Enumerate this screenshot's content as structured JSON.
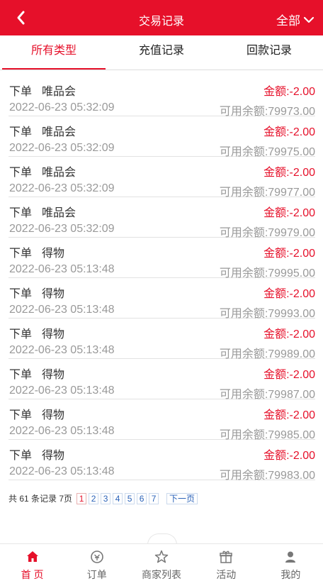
{
  "header": {
    "title": "交易记录",
    "filter_label": "全部"
  },
  "tabs": [
    {
      "label": "所有类型",
      "active": true
    },
    {
      "label": "充值记录",
      "active": false
    },
    {
      "label": "回款记录",
      "active": false
    }
  ],
  "records": [
    {
      "type": "下单",
      "merchant": "唯品会",
      "amount": "金额:-2.00",
      "time": "2022-06-23 05:32:09",
      "balance": "可用余额:79973.00"
    },
    {
      "type": "下单",
      "merchant": "唯品会",
      "amount": "金额:-2.00",
      "time": "2022-06-23 05:32:09",
      "balance": "可用余额:79975.00"
    },
    {
      "type": "下单",
      "merchant": "唯品会",
      "amount": "金额:-2.00",
      "time": "2022-06-23 05:32:09",
      "balance": "可用余额:79977.00"
    },
    {
      "type": "下单",
      "merchant": "唯品会",
      "amount": "金额:-2.00",
      "time": "2022-06-23 05:32:09",
      "balance": "可用余额:79979.00"
    },
    {
      "type": "下单",
      "merchant": "得物",
      "amount": "金额:-2.00",
      "time": "2022-06-23 05:13:48",
      "balance": "可用余额:79995.00"
    },
    {
      "type": "下单",
      "merchant": "得物",
      "amount": "金额:-2.00",
      "time": "2022-06-23 05:13:48",
      "balance": "可用余额:79993.00"
    },
    {
      "type": "下单",
      "merchant": "得物",
      "amount": "金额:-2.00",
      "time": "2022-06-23 05:13:48",
      "balance": "可用余额:79989.00"
    },
    {
      "type": "下单",
      "merchant": "得物",
      "amount": "金额:-2.00",
      "time": "2022-06-23 05:13:48",
      "balance": "可用余额:79987.00"
    },
    {
      "type": "下单",
      "merchant": "得物",
      "amount": "金额:-2.00",
      "time": "2022-06-23 05:13:48",
      "balance": "可用余额:79985.00"
    },
    {
      "type": "下单",
      "merchant": "得物",
      "amount": "金额:-2.00",
      "time": "2022-06-23 05:13:48",
      "balance": "可用余额:79983.00"
    }
  ],
  "pagination": {
    "summary": "共 61 条记录 7页",
    "pages": [
      "1",
      "2",
      "3",
      "4",
      "5",
      "6",
      "7"
    ],
    "current_page": "1",
    "next_label": "下一页"
  },
  "bottom_nav": [
    {
      "label": "首 页",
      "icon": "home-icon",
      "active": true
    },
    {
      "label": "订单",
      "icon": "order-icon",
      "active": false
    },
    {
      "label": "商家列表",
      "icon": "star-icon",
      "active": false
    },
    {
      "label": "活动",
      "icon": "gift-icon",
      "active": false
    },
    {
      "label": "我的",
      "icon": "user-icon",
      "active": false
    }
  ],
  "colors": {
    "brand": "#e6102a",
    "muted_text": "#999999",
    "link": "#2a62b8"
  }
}
